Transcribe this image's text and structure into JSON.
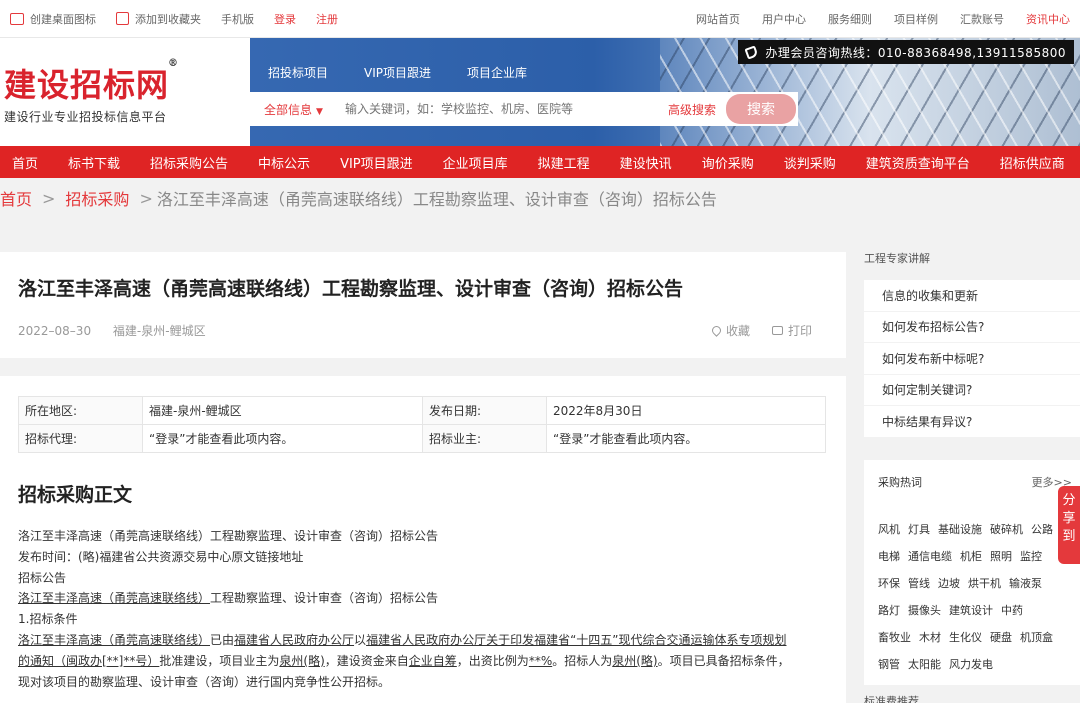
{
  "topbar": {
    "left": [
      "创建桌面图标",
      "添加到收藏夹",
      "手机版",
      "登录",
      "注册"
    ],
    "right": [
      "网站首页",
      "用户中心",
      "服务细则",
      "项目样例",
      "汇款账号",
      "资讯中心"
    ]
  },
  "header": {
    "logo": "建设招标网",
    "reg_mark": "®",
    "slogan": "建设行业专业招投标信息平台",
    "hotline": "办理会员咨询热线：010-88368498,13911585800",
    "tabs": [
      "招投标项目",
      "VIP项目跟进",
      "项目企业库"
    ],
    "search": {
      "scope": "全部信息",
      "scope_arrow": "▼",
      "placeholder": "输入关键词，如：学校监控、机房、医院等",
      "advanced": "高级搜索",
      "button": "搜索"
    }
  },
  "nav": [
    "首页",
    "标书下载",
    "招标采购公告",
    "中标公示",
    "VIP项目跟进",
    "企业项目库",
    "拟建工程",
    "建设快讯",
    "询价采购",
    "谈判采购",
    "建筑资质查询平台",
    "招标供应商"
  ],
  "breadcrumb": {
    "home": "首页",
    "section": "招标采购",
    "sep": ">",
    "current": "洛江至丰泽高速（甬莞高速联络线）工程勘察监理、设计审查（咨询）招标公告"
  },
  "article": {
    "title": "洛江至丰泽高速（甬莞高速联络线）工程勘察监理、设计审查（咨询）招标公告",
    "date": "2022–08–30",
    "region": "福建-泉州-鲤城区",
    "favorite": "收藏",
    "print": "打印",
    "info": {
      "region_label": "所在地区:",
      "region_value": "福建-泉州-鲤城区",
      "date_label": "发布日期:",
      "date_value": "2022年8月30日",
      "agent_label": "招标代理:",
      "agent_value": "“登录”才能查看此项内容。",
      "owner_label": "招标业主:",
      "owner_value": "“登录”才能查看此项内容。"
    },
    "body_title": "招标采购正文",
    "lines": {
      "l1": "洛江至丰泽高速（甬莞高速联络线）工程勘察监理、设计审查（咨询）招标公告",
      "l2": "发布时间：(略)福建省公共资源交易中心原文链接地址",
      "l3": "招标公告",
      "l4a": "洛江至丰泽高速（甬莞高速联络线）",
      "l4b": "工程勘察监理、设计审查（咨询）招标公告",
      "l5": "1.招标条件",
      "l6a": "洛江至丰泽高速（甬莞高速联络线）",
      "l6b": "已由",
      "l6c": "福建省人民政府办公厅",
      "l6d": "以",
      "l6e": "福建省人民政府办公厅关于印发福建省“十四五”现代综合交通运输体系专项规划",
      "l7a": "的通知（闽政办[**]**号）",
      "l7b": "批准建设，项目业主为",
      "l7c": "泉州(略)",
      "l7d": "，建设资金来自",
      "l7e": "企业自筹",
      "l7f": "，出资比例为",
      "l7g": "**%",
      "l7h": "。招标人为",
      "l7i": "泉州(略)",
      "l7j": "。项目已具备招标条件，",
      "l8": "现对该项目的勘察监理、设计审查（咨询）进行国内竞争性公开招标。"
    }
  },
  "sidebar": {
    "expert_title": "工程专家讲解",
    "expert_items": [
      "信息的收集和更新",
      "如何发布招标公告?",
      "如何发布新中标呢?",
      "如何定制关键词?",
      "中标结果有异议?"
    ],
    "hot_title": "采购热词",
    "more": "更多>>",
    "hot_rows": [
      [
        "风机",
        "灯具",
        "基础设施",
        "破碎机",
        "公路"
      ],
      [
        "电梯",
        "通信电缆",
        "机柜",
        "照明",
        "监控"
      ],
      [
        "环保",
        "管线",
        "边坡",
        "烘干机",
        "输液泵"
      ],
      [
        "路灯",
        "摄像头",
        "建筑设计",
        "中药"
      ],
      [
        "畜牧业",
        "木材",
        "生化仪",
        "硬盘",
        "机顶盒"
      ],
      [
        "钢管",
        "太阳能",
        "风力发电"
      ]
    ],
    "bottom_title": "标准费推荐"
  },
  "share": "分享到"
}
